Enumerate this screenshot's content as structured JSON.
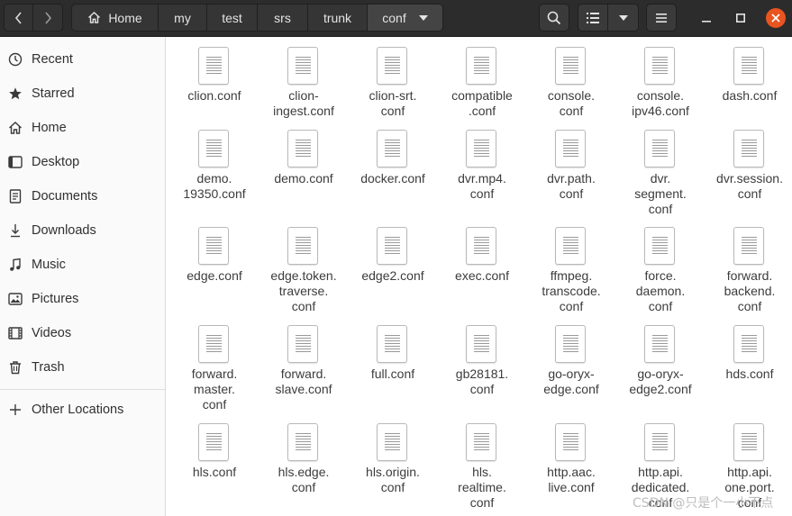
{
  "header": {
    "breadcrumbs": [
      {
        "label": "Home"
      },
      {
        "label": "my"
      },
      {
        "label": "test"
      },
      {
        "label": "srs"
      },
      {
        "label": "trunk"
      },
      {
        "label": "conf"
      }
    ],
    "icons": [
      "back-icon",
      "forward-icon",
      "home-icon",
      "chevron-down-icon",
      "search-icon",
      "list-view-icon",
      "chevron-down-icon",
      "hamburger-menu-icon",
      "minimize-icon",
      "maximize-icon",
      "close-icon"
    ]
  },
  "sidebar": {
    "items": [
      {
        "label": "Recent",
        "icon": "clock-icon"
      },
      {
        "label": "Starred",
        "icon": "star-icon"
      },
      {
        "label": "Home",
        "icon": "home-icon"
      },
      {
        "label": "Desktop",
        "icon": "desktop-icon"
      },
      {
        "label": "Documents",
        "icon": "documents-icon"
      },
      {
        "label": "Downloads",
        "icon": "download-icon"
      },
      {
        "label": "Music",
        "icon": "music-icon"
      },
      {
        "label": "Pictures",
        "icon": "pictures-icon"
      },
      {
        "label": "Videos",
        "icon": "videos-icon"
      },
      {
        "label": "Trash",
        "icon": "trash-icon"
      }
    ],
    "other_locations": {
      "label": "Other Locations",
      "icon": "plus-icon"
    }
  },
  "files": [
    {
      "name": "clion.conf"
    },
    {
      "name": "clion-\ningest.conf"
    },
    {
      "name": "clion-srt.\nconf"
    },
    {
      "name": "compatible\n.conf"
    },
    {
      "name": "console.\nconf"
    },
    {
      "name": "console.\nipv46.conf"
    },
    {
      "name": "dash.conf"
    },
    {
      "name": "demo.\n19350.conf"
    },
    {
      "name": "demo.conf"
    },
    {
      "name": "docker.conf"
    },
    {
      "name": "dvr.mp4.\nconf"
    },
    {
      "name": "dvr.path.\nconf"
    },
    {
      "name": "dvr.\nsegment.\nconf"
    },
    {
      "name": "dvr.session.\nconf"
    },
    {
      "name": "edge.conf"
    },
    {
      "name": "edge.token.\ntraverse.\nconf"
    },
    {
      "name": "edge2.conf"
    },
    {
      "name": "exec.conf"
    },
    {
      "name": "ffmpeg.\ntranscode.\nconf"
    },
    {
      "name": "force.\ndaemon.\nconf"
    },
    {
      "name": "forward.\nbackend.\nconf"
    },
    {
      "name": "forward.\nmaster.\nconf"
    },
    {
      "name": "forward.\nslave.conf"
    },
    {
      "name": "full.conf"
    },
    {
      "name": "gb28181.\nconf"
    },
    {
      "name": "go-oryx-\nedge.conf"
    },
    {
      "name": "go-oryx-\nedge2.conf"
    },
    {
      "name": "hds.conf"
    },
    {
      "name": "hls.conf"
    },
    {
      "name": "hls.edge.\nconf"
    },
    {
      "name": "hls.origin.\nconf"
    },
    {
      "name": "hls.\nrealtime.\nconf"
    },
    {
      "name": "http.aac.\nlive.conf"
    },
    {
      "name": "http.api.\ndedicated.\nconf"
    },
    {
      "name": "http.api.\none.port.\nconf"
    }
  ],
  "watermark": "CSDN @只是个一小不点",
  "colors": {
    "header_bg": "#2c2c2c",
    "close_button": "#e95420",
    "sidebar_bg": "#fafafa"
  }
}
